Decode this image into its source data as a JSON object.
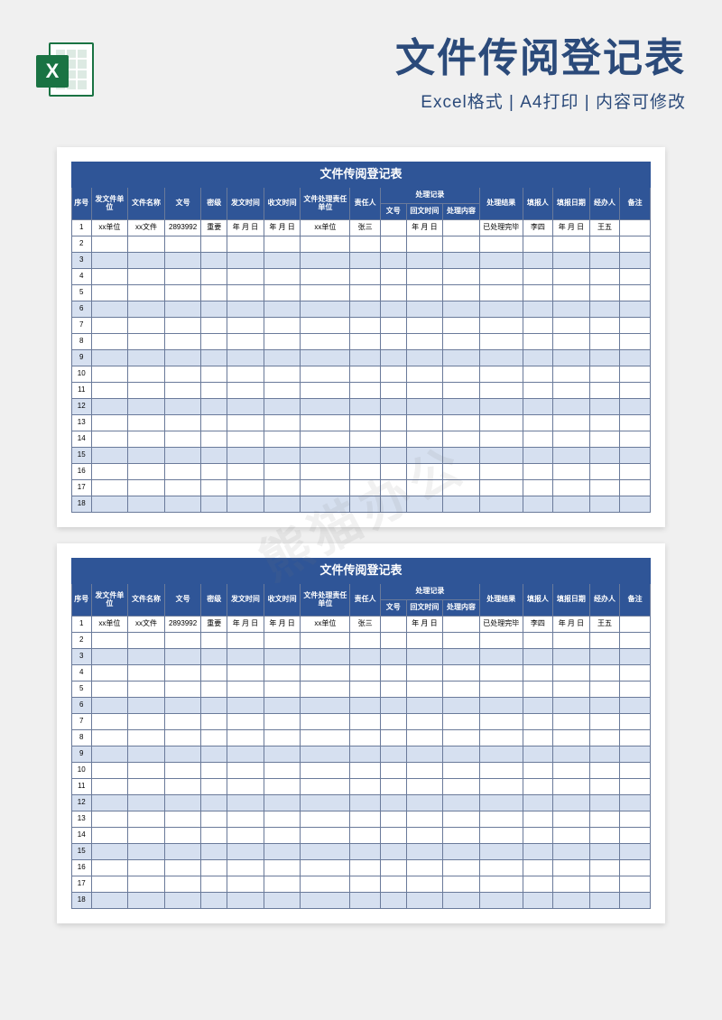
{
  "header": {
    "main_title": "文件传阅登记表",
    "sub_title": "Excel格式 | A4打印 | 内容可修改",
    "icon_letter": "X"
  },
  "table": {
    "title": "文件传阅登记表",
    "columns": {
      "seq": "序号",
      "send_unit": "发文件单位",
      "file_name": "文件名称",
      "file_no": "文号",
      "level": "密级",
      "send_time": "发文时间",
      "recv_time": "收文时间",
      "resp_unit": "文件处理责任单位",
      "resp_person": "责任人",
      "record_group": "处理记录",
      "rec_no": "文号",
      "rec_time": "回文时间",
      "rec_content": "处理内容",
      "result": "处理结果",
      "filler": "填报人",
      "fill_date": "填报日期",
      "handler": "经办人",
      "remark": "备注"
    },
    "row1": {
      "seq": "1",
      "send_unit": "xx单位",
      "file_name": "xx文件",
      "file_no": "2893992",
      "level": "重要",
      "send_time": "年 月 日",
      "recv_time": "年 月 日",
      "resp_unit": "xx单位",
      "resp_person": "张三",
      "rec_no": "",
      "rec_time": "年 月 日",
      "rec_content": "",
      "result": "已处理完毕",
      "filler": "李四",
      "fill_date": "年 月 日",
      "handler": "王五",
      "remark": ""
    },
    "row_count": 18
  },
  "watermark": "熊猫办公"
}
